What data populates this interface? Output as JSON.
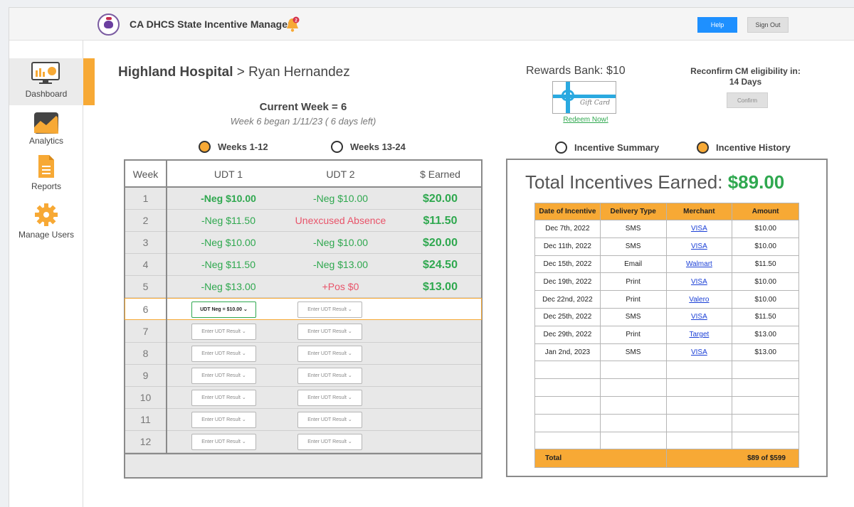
{
  "app": {
    "title": "CA DHCS State Incentive Manager",
    "notification_count": "2"
  },
  "header": {
    "help_label": "Help",
    "signout_label": "Sign Out"
  },
  "sidebar": {
    "items": [
      {
        "label": "Dashboard",
        "icon": "dashboard-icon"
      },
      {
        "label": "Analytics",
        "icon": "analytics-icon"
      },
      {
        "label": "Reports",
        "icon": "reports-icon"
      },
      {
        "label": "Manage Users",
        "icon": "gear-icon"
      }
    ]
  },
  "breadcrumb": {
    "hospital": "Highland Hospital",
    "separator": " > ",
    "patient": "Ryan Hernandez"
  },
  "week": {
    "title": "Current Week = 6",
    "subtitle": "Week 6 began 1/11/23 ( 6 days left)"
  },
  "week_filter": {
    "option1": "Weeks 1-12",
    "option2": "Weeks 13-24",
    "selected": "Weeks 1-12"
  },
  "udt_table": {
    "headers": {
      "week": "Week",
      "udt1": "UDT 1",
      "udt2": "UDT 2",
      "earned": "$ Earned"
    },
    "select_placeholder": "Enter UDT Result",
    "rows": [
      {
        "week": "1",
        "udt1": "-Neg $10.00",
        "udt2": "-Neg $10.00",
        "earned": "$20.00"
      },
      {
        "week": "2",
        "udt1": "-Neg $11.50",
        "udt2": "Unexcused Absence",
        "earned": "$11.50"
      },
      {
        "week": "3",
        "udt1": "-Neg $10.00",
        "udt2": "-Neg $10.00",
        "earned": "$20.00"
      },
      {
        "week": "4",
        "udt1": "-Neg $11.50",
        "udt2": "-Neg $13.00",
        "earned": "$24.50"
      },
      {
        "week": "5",
        "udt1": "-Neg $13.00",
        "udt2": "+Pos $0",
        "earned": "$13.00"
      },
      {
        "week": "6",
        "udt1": "UDT Neg = $10.00",
        "udt2": "Enter UDT Result",
        "earned": ""
      },
      {
        "week": "7"
      },
      {
        "week": "8"
      },
      {
        "week": "9"
      },
      {
        "week": "10"
      },
      {
        "week": "11"
      },
      {
        "week": "12"
      }
    ]
  },
  "rewards": {
    "bank": "Rewards Bank: $10",
    "card_text": "Gift Card",
    "redeem_label": "Redeem Now!"
  },
  "reconfirm": {
    "line1": "Reconfirm CM eligibility in:",
    "line2": "14 Days",
    "confirm_label": "Confirm"
  },
  "incentive_view": {
    "option1": "Incentive Summary",
    "option2": "Incentive History",
    "selected": "Incentive History"
  },
  "history": {
    "title_prefix": "Total Incentives Earned: ",
    "title_amount": "$89.00",
    "headers": [
      "Date of Incentive",
      "Delivery Type",
      "Merchant",
      "Amount"
    ],
    "rows": [
      [
        "Dec 7th, 2022",
        "SMS",
        "VISA",
        "$10.00"
      ],
      [
        "Dec 11th, 2022",
        "SMS",
        "VISA",
        "$10.00"
      ],
      [
        "Dec 15th, 2022",
        "Email",
        "Walmart",
        "$11.50"
      ],
      [
        "Dec 19th, 2022",
        "Print",
        "VISA",
        "$10.00"
      ],
      [
        "Dec 22nd, 2022",
        "Print",
        "Valero",
        "$10.00"
      ],
      [
        "Dec 25th, 2022",
        "SMS",
        "VISA",
        "$11.50"
      ],
      [
        "Dec 29th, 2022",
        "Print",
        "Target",
        "$13.00"
      ],
      [
        "Jan 2nd, 2023",
        "SMS",
        "VISA",
        "$13.00"
      ]
    ],
    "total_label": "Total",
    "total_value": "$89 of $599"
  },
  "colors": {
    "accent": "#f7a935",
    "primary": "#1e90ff",
    "positive": "#2fa84f",
    "negative": "#e8546a",
    "link": "#1a3fd6"
  }
}
